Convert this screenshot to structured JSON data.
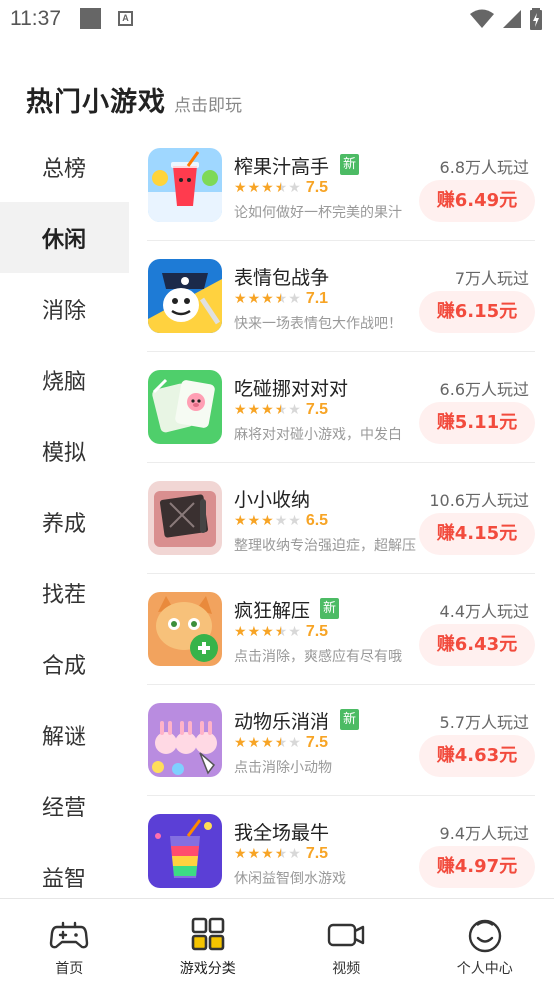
{
  "status_bar": {
    "time": "11:37",
    "a_glyph": "A"
  },
  "header": {
    "title": "热门小游戏",
    "subtitle": "点击即玩"
  },
  "sidebar": {
    "items": [
      {
        "label": "总榜",
        "active": false
      },
      {
        "label": "休闲",
        "active": true
      },
      {
        "label": "消除",
        "active": false
      },
      {
        "label": "烧脑",
        "active": false
      },
      {
        "label": "模拟",
        "active": false
      },
      {
        "label": "养成",
        "active": false
      },
      {
        "label": "找茬",
        "active": false
      },
      {
        "label": "合成",
        "active": false
      },
      {
        "label": "解谜",
        "active": false
      },
      {
        "label": "经营",
        "active": false
      },
      {
        "label": "益智",
        "active": false
      }
    ]
  },
  "new_badge_label": "新",
  "games": [
    {
      "name": "榨果汁高手",
      "is_new": true,
      "rating": 7.5,
      "stars": 3.5,
      "rating_text": "7.5",
      "desc": "论如何做好一杯完美的果汁",
      "players": "6.8万人玩过",
      "earn": "赚6.49元",
      "icon": "juice-cup-icon"
    },
    {
      "name": "表情包战争",
      "is_new": false,
      "rating": 7.1,
      "stars": 3.5,
      "rating_text": "7.1",
      "desc": "快来一场表情包大作战吧！",
      "players": "7万人玩过",
      "earn": "赚6.15元",
      "icon": "meme-pirate-icon"
    },
    {
      "name": "吃碰挪对对对",
      "is_new": false,
      "rating": 7.5,
      "stars": 3.5,
      "rating_text": "7.5",
      "desc": "麻将对对碰小游戏，中发白",
      "players": "6.6万人玩过",
      "earn": "赚5.11元",
      "icon": "mahjong-tile-icon"
    },
    {
      "name": "小小收纳",
      "is_new": false,
      "rating": 6.5,
      "stars": 3,
      "rating_text": "6.5",
      "desc": "整理收纳专治强迫症，超解压",
      "players": "10.6万人玩过",
      "earn": "赚4.15元",
      "icon": "storage-box-icon"
    },
    {
      "name": "疯狂解压",
      "is_new": true,
      "rating": 7.5,
      "stars": 3.5,
      "rating_text": "7.5",
      "desc": "点击消除，爽感应有尽有哦",
      "players": "4.4万人玩过",
      "earn": "赚6.43元",
      "icon": "cat-relax-icon"
    },
    {
      "name": "动物乐消消",
      "is_new": true,
      "rating": 7.5,
      "stars": 3.5,
      "rating_text": "7.5",
      "desc": "点击消除小动物",
      "players": "5.7万人玩过",
      "earn": "赚4.63元",
      "icon": "bunny-match-icon"
    },
    {
      "name": "我全场最牛",
      "is_new": false,
      "rating": 7.5,
      "stars": 3.5,
      "rating_text": "7.5",
      "desc": "休闲益智倒水游戏",
      "players": "9.4万人玩过",
      "earn": "赚4.97元",
      "icon": "layered-drink-icon"
    }
  ],
  "bottom_nav": [
    {
      "label": "首页",
      "icon": "gamepad-icon",
      "active": false
    },
    {
      "label": "游戏分类",
      "icon": "grid-category-icon",
      "active": true
    },
    {
      "label": "视频",
      "icon": "video-camera-icon",
      "active": false
    },
    {
      "label": "个人中心",
      "icon": "smile-face-icon",
      "active": false
    }
  ],
  "colors": {
    "accent": "#f24b3d",
    "earn_bg": "#fff0ef",
    "star": "#f7a425",
    "new_badge": "#4cbb64",
    "active_tab": "#f5c400"
  }
}
